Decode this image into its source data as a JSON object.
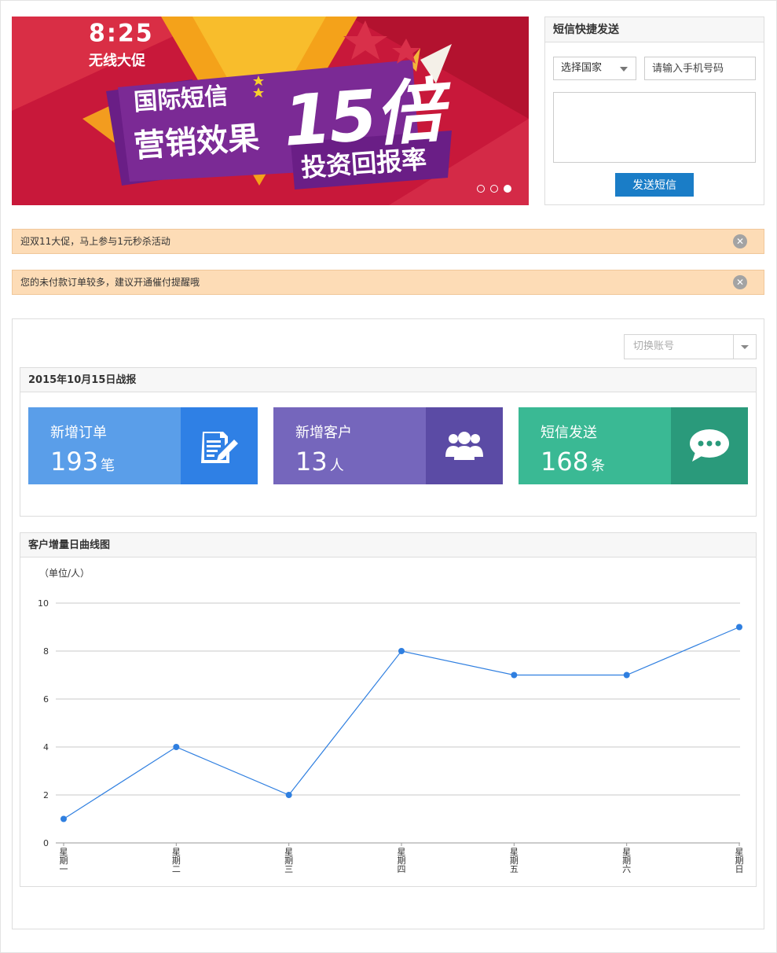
{
  "banner": {
    "time": "8:25",
    "promo": "无线大促",
    "line1": "国际短信",
    "line2": "营销效果",
    "big": "15倍",
    "line3": "投资回报率",
    "slides": 3,
    "active_slide": 3
  },
  "sms_panel": {
    "title": "短信快捷发送",
    "country_select": "选择国家",
    "phone_placeholder": "请输入手机号码",
    "send_label": "发送短信"
  },
  "notices": [
    {
      "text": "迎双11大促，马上参与1元秒杀活动"
    },
    {
      "text": "您的未付款订单较多，建议开通催付提醒哦"
    }
  ],
  "account_switch": {
    "label": "切换账号"
  },
  "report": {
    "title": "2015年10月15日战报",
    "cards": [
      {
        "title": "新增订单",
        "value": "193",
        "unit": "笔",
        "icon": "edit-document-icon",
        "color": "#5a9ee9",
        "icon_bg": "#2f80e5"
      },
      {
        "title": "新增客户",
        "value": "13",
        "unit": "人",
        "icon": "users-icon",
        "color": "#7566bc",
        "icon_bg": "#5b4ba5"
      },
      {
        "title": "短信发送",
        "value": "168",
        "unit": "条",
        "icon": "chat-bubble-icon",
        "color": "#3ab994",
        "icon_bg": "#2a9a7b"
      }
    ]
  },
  "chart": {
    "title": "客户增量日曲线图",
    "unit_label": "（单位/人）"
  },
  "chart_data": {
    "type": "line",
    "categories": [
      "星期一",
      "星期二",
      "星期三",
      "星期四",
      "星期五",
      "星期六",
      "星期日"
    ],
    "series": [
      {
        "values": [
          1,
          4,
          2,
          8,
          7,
          7,
          9
        ]
      }
    ],
    "ylim": [
      0,
      10
    ],
    "yticks": [
      0,
      2,
      4,
      6,
      8,
      10
    ],
    "grid": true,
    "line_color": "#2f7fe0"
  }
}
